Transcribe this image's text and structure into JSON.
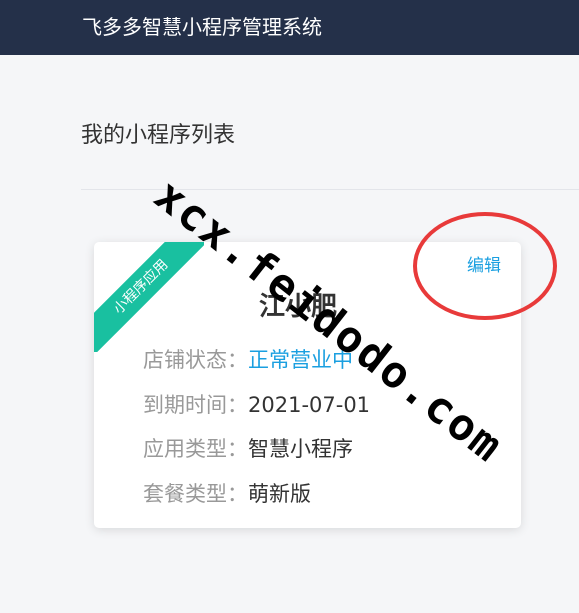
{
  "header": {
    "app_title": "飞多多智慧小程序管理系统"
  },
  "main": {
    "page_title": "我的小程序列表",
    "card": {
      "ribbon_label": "小程序应用",
      "edit_label": "编辑",
      "store_name": "江小肥",
      "rows": [
        {
          "label": "店铺状态：",
          "value": "正常营业中"
        },
        {
          "label": "到期时间：",
          "value": "2021-07-01"
        },
        {
          "label": "应用类型：",
          "value": "智慧小程序"
        },
        {
          "label": "套餐类型：",
          "value": "萌新版"
        }
      ]
    }
  },
  "overlay": {
    "watermark_text": "xcx.feidodo.com"
  },
  "colors": {
    "header_bg": "#243049",
    "ribbon": "#19c0a0",
    "link": "#1a9fe0",
    "annotation_circle": "#e83a3a"
  }
}
